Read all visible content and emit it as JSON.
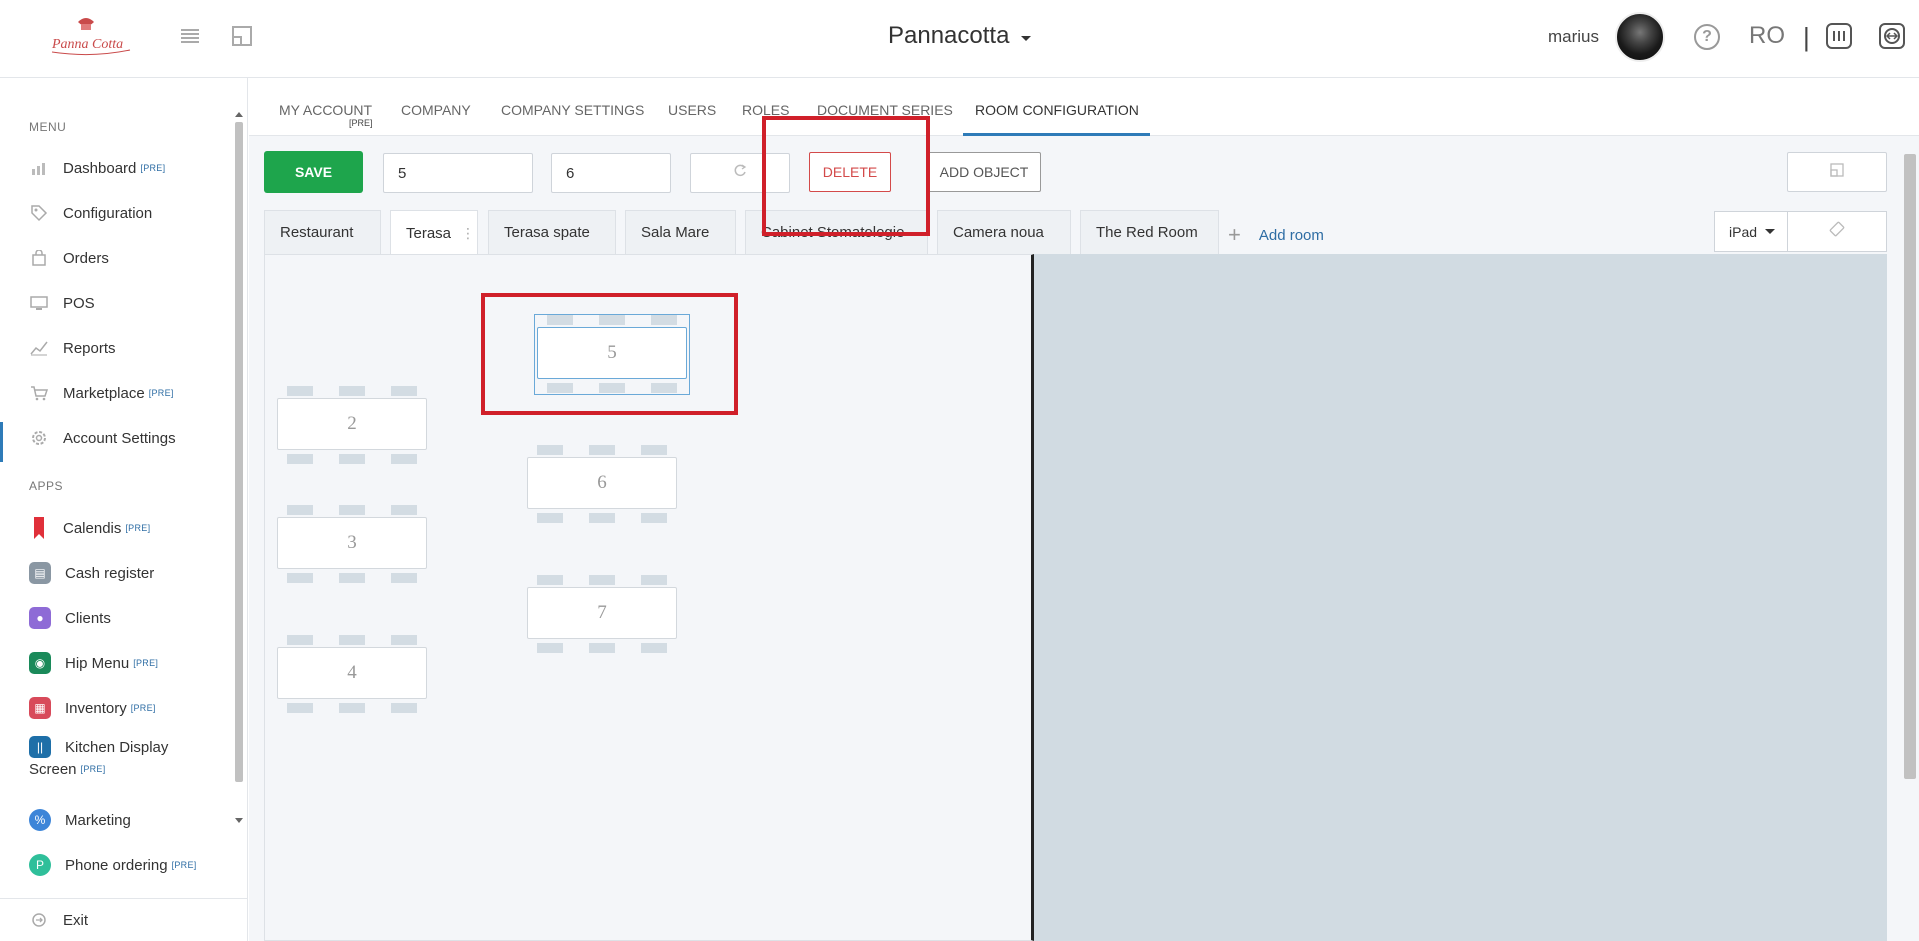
{
  "header": {
    "logo_text": "Panna Cotta",
    "company_name": "Pannacotta",
    "username": "marius",
    "language": "RO",
    "separator": "|"
  },
  "sidebar": {
    "menu_label": "MENU",
    "apps_label": "APPS",
    "menu_items": [
      {
        "label": "Dashboard",
        "pre": "[PRE]",
        "icon": "chart-icon"
      },
      {
        "label": "Configuration",
        "pre": "",
        "icon": "tag-icon"
      },
      {
        "label": "Orders",
        "pre": "",
        "icon": "bag-icon"
      },
      {
        "label": "POS",
        "pre": "",
        "icon": "monitor-icon"
      },
      {
        "label": "Reports",
        "pre": "",
        "icon": "trend-icon"
      },
      {
        "label": "Marketplace",
        "pre": "[PRE]",
        "icon": "cart-icon"
      },
      {
        "label": "Account Settings",
        "pre": "",
        "icon": "gear-icon"
      }
    ],
    "app_items": [
      {
        "label": "Calendis",
        "pre": "[PRE]",
        "color": "#e0303a"
      },
      {
        "label": "Cash register",
        "pre": "",
        "color": "#8a97a3"
      },
      {
        "label": "Clients",
        "pre": "",
        "color": "#8e6bd6"
      },
      {
        "label": "Hip Menu",
        "pre": "[PRE]",
        "color": "#1a8a5a"
      },
      {
        "label": "Inventory",
        "pre": "[PRE]",
        "color": "#d84a5a"
      },
      {
        "label": "Kitchen Display",
        "label2": "Screen",
        "pre": "[PRE]",
        "color": "#1e6fa8"
      },
      {
        "label": "Marketing",
        "pre": "",
        "color": "#3d85d8"
      },
      {
        "label": "Phone ordering",
        "pre": "[PRE]",
        "color": "#2fbf9a"
      }
    ],
    "exit_label": "Exit"
  },
  "tabs": {
    "items": [
      "MY ACCOUNT",
      "COMPANY",
      "COMPANY SETTINGS",
      "USERS",
      "ROLES",
      "DOCUMENT SERIES",
      "ROOM CONFIGURATION"
    ],
    "my_account_pre": "[PRE]",
    "active": "ROOM CONFIGURATION"
  },
  "toolbar": {
    "save_label": "SAVE",
    "field1_value": "5",
    "field2_value": "6",
    "delete_label": "DELETE",
    "add_object_label": "ADD OBJECT"
  },
  "rooms": {
    "items": [
      "Restaurant",
      "Terasa",
      "Terasa spate",
      "Sala Mare",
      "Cabinet Stomatologie",
      "Camera noua",
      "The Red Room"
    ],
    "active": "Terasa",
    "add_room_label": "Add room",
    "device": "iPad"
  },
  "tables": [
    {
      "number": "5",
      "selected": true
    },
    {
      "number": "2",
      "selected": false
    },
    {
      "number": "6",
      "selected": false
    },
    {
      "number": "3",
      "selected": false
    },
    {
      "number": "7",
      "selected": false
    },
    {
      "number": "4",
      "selected": false
    }
  ],
  "colors": {
    "accent": "#2e7bb8",
    "save": "#1ea54c",
    "delete": "#d34a4a",
    "highlight": "#d0202a"
  }
}
